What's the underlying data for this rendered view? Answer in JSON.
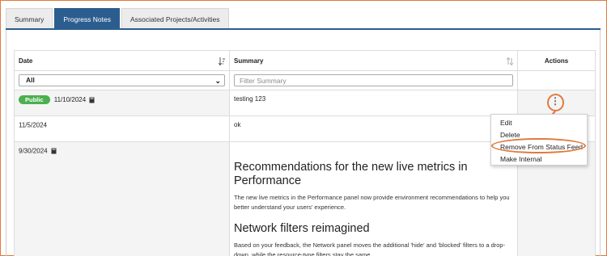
{
  "tabs": [
    {
      "label": "Summary"
    },
    {
      "label": "Progress Notes"
    },
    {
      "label": "Associated Projects/Activities"
    }
  ],
  "table": {
    "headers": {
      "date": "Date",
      "summary": "Summary",
      "actions": "Actions"
    },
    "filters": {
      "date_selected": "All",
      "summary_placeholder": "Filter Summary"
    },
    "rows": [
      {
        "badge": "Public",
        "date": "11/10/2024",
        "summary": "testing 123"
      },
      {
        "date": "11/5/2024",
        "summary": "ok"
      },
      {
        "date": "9/30/2024",
        "article": {
          "heading1": "Recommendations for the new live metrics in Performance",
          "para1": "The new live metrics in the Performance panel now provide environment recommendations to help you better understand your users' experience.",
          "heading2": "Network filters reimagined",
          "para2": "Based on your feedback, the Network panel moves the additional 'hide' and 'blocked' filters to a drop-down, while the resource-type filters stay the same."
        }
      }
    ]
  },
  "actions_menu": {
    "items": [
      "Edit",
      "Delete",
      "Remove From Status Feed",
      "Make Internal"
    ]
  },
  "colors": {
    "accent": "#2c5d8f",
    "badge": "#4caf50",
    "annotation": "#e07a3c"
  },
  "icons": [
    "sort-icon",
    "note-icon",
    "kebab-icon",
    "chevron-down-icon"
  ]
}
